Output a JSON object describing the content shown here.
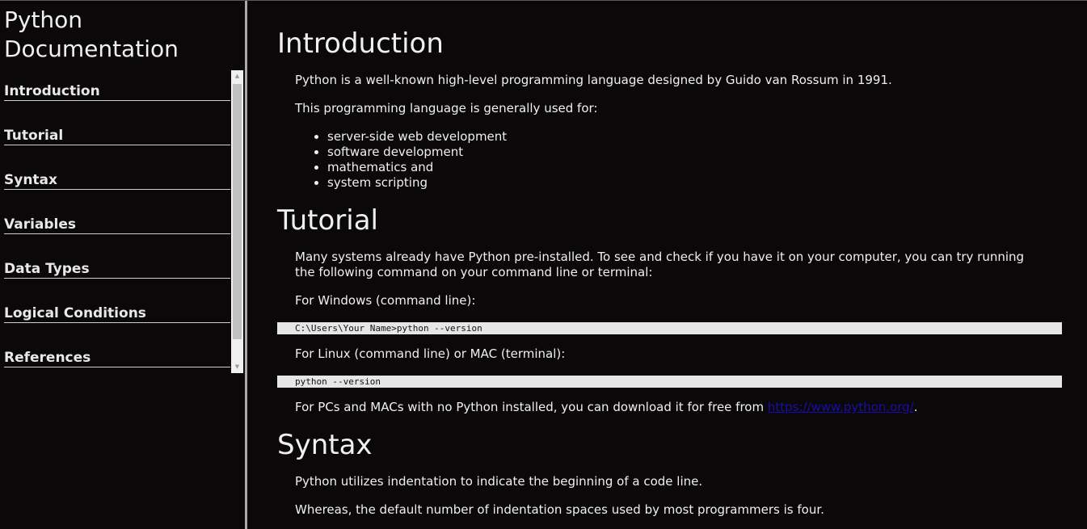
{
  "sidebar": {
    "title": "Python Documentation",
    "items": [
      {
        "label": "Introduction"
      },
      {
        "label": "Tutorial"
      },
      {
        "label": "Syntax"
      },
      {
        "label": "Variables"
      },
      {
        "label": "Data Types"
      },
      {
        "label": "Logical Conditions"
      },
      {
        "label": "References"
      }
    ]
  },
  "main": {
    "introduction": {
      "heading": "Introduction",
      "p1": "Python is a well-known high-level programming language designed by Guido van Rossum in 1991.",
      "p2": "This programming language is generally used for:",
      "bullets": [
        "server-side web development",
        "software development",
        "mathematics and",
        "system scripting"
      ]
    },
    "tutorial": {
      "heading": "Tutorial",
      "p1": "Many systems already have Python pre-installed. To see and check if you have it on your computer, you can try running the following command on your command line or terminal:",
      "p2": "For Windows (command line):",
      "code1": "C:\\Users\\Your Name>python --version",
      "p3": "For Linux (command line) or MAC (terminal):",
      "code2": "python --version",
      "p4_prefix": "For PCs and MACs with no Python installed, you can download it for free from ",
      "p4_link": "https://www.python.org/",
      "p4_suffix": "."
    },
    "syntax": {
      "heading": "Syntax",
      "p1": "Python utilizes indentation to indicate the beginning of a code line.",
      "p2": "Whereas, the default number of indentation spaces used by most programmers is four."
    }
  },
  "colors": {
    "background": "#0b0809",
    "text": "#f0f0f0",
    "code_background": "#e6e6e6",
    "link": "#1a0dab",
    "divider": "#a9a9a9"
  }
}
